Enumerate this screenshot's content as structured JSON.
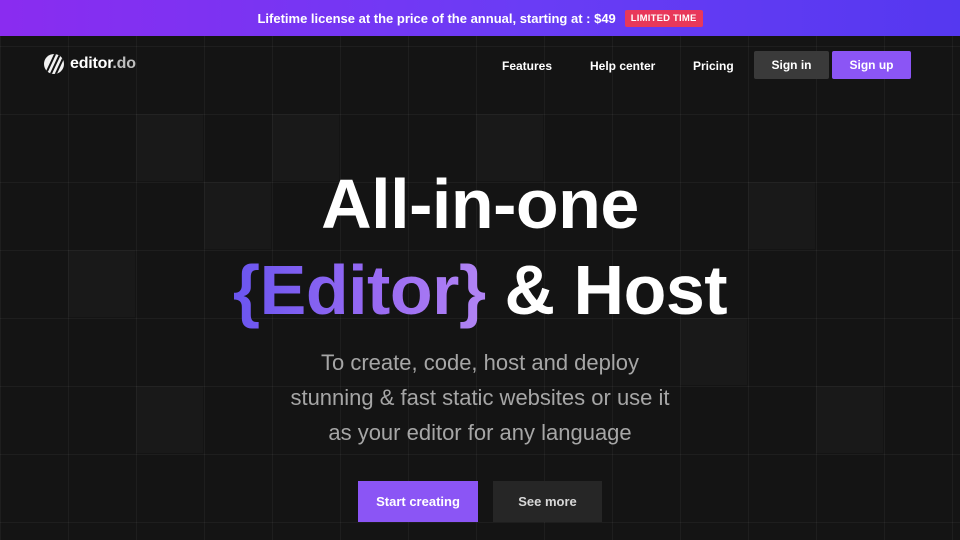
{
  "promo": {
    "text": "Lifetime license at the price of the annual, starting at : $49",
    "badge": "LIMITED TIME"
  },
  "nav": {
    "logo_text": "editor",
    "logo_suffix": ".do",
    "links": [
      "Features",
      "Help center",
      "Pricing"
    ],
    "sign_in": "Sign in",
    "sign_up": "Sign up"
  },
  "hero": {
    "line1": "All-in-one",
    "line2_highlight": "{Editor}",
    "line2_rest": " & Host",
    "subtitle_lines": [
      "To create, code, host and deploy",
      "stunning & fast static websites or use it",
      "as your editor for any language"
    ],
    "cta_primary": "Start creating",
    "cta_secondary": "See more"
  },
  "colors": {
    "accent": "#8b55f5",
    "background": "#141414",
    "badge": "#e8385a"
  }
}
